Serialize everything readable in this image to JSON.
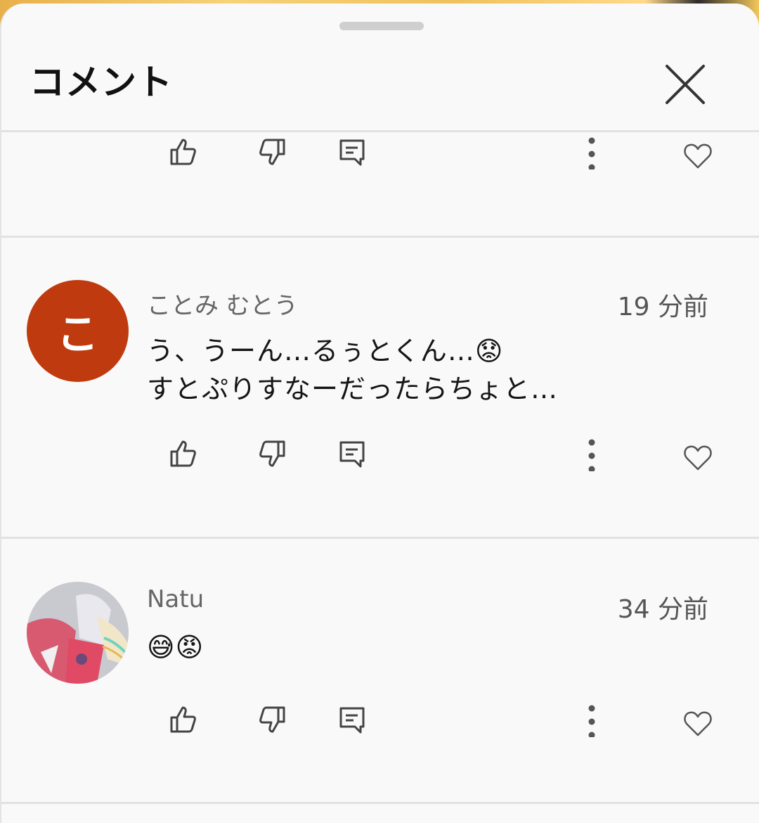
{
  "sheet": {
    "title": "コメント"
  },
  "comments": [
    {
      "author": "ことみ むとう",
      "avatar_letter": "こ",
      "avatar_color": "#c03a10",
      "time": "19 分前",
      "lines": [
        "う、うーん…るぅとくん…😟",
        "すとぷりすなーだったらちょと…"
      ]
    },
    {
      "author": "Natu",
      "time": "34 分前",
      "lines": [
        "😅😡"
      ]
    }
  ],
  "icons": {
    "like": "thumbs-up-icon",
    "dislike": "thumbs-down-icon",
    "reply": "reply-icon",
    "more": "more-vert-icon",
    "heart": "heart-icon",
    "close": "close-icon"
  }
}
